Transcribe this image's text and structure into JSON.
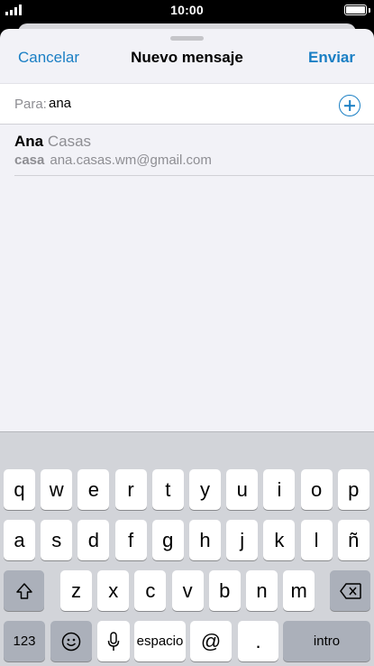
{
  "status_bar": {
    "time": "10:00",
    "signal_icon": "cellular-signal-icon",
    "battery_icon": "battery-icon",
    "battery_level": 1.0
  },
  "nav": {
    "cancel_label": "Cancelar",
    "title": "Nuevo mensaje",
    "send_label": "Enviar"
  },
  "to_field": {
    "label": "Para:",
    "value": "ana",
    "add_icon": "add-contact-icon"
  },
  "suggestion": {
    "first_name": "Ana",
    "last_name": "Casas",
    "kind": "casa",
    "email": "ana.casas.wm@gmail.com"
  },
  "keyboard": {
    "row1": [
      "q",
      "w",
      "e",
      "r",
      "t",
      "y",
      "u",
      "i",
      "o",
      "p"
    ],
    "row2": [
      "a",
      "s",
      "d",
      "f",
      "g",
      "h",
      "j",
      "k",
      "l",
      "ñ"
    ],
    "row3": [
      "z",
      "x",
      "c",
      "v",
      "b",
      "n",
      "m"
    ],
    "numbers_label": "123",
    "space_label": "espacio",
    "at_label": "@",
    "dot_label": ".",
    "return_label": "intro",
    "shift_icon": "shift-icon",
    "delete_icon": "delete-icon",
    "emoji_icon": "emoji-icon",
    "mic_icon": "microphone-icon"
  },
  "colors": {
    "accent": "#1a7fc4",
    "keyboard_bg": "#d2d4d9",
    "special_key": "#abb0ba"
  }
}
